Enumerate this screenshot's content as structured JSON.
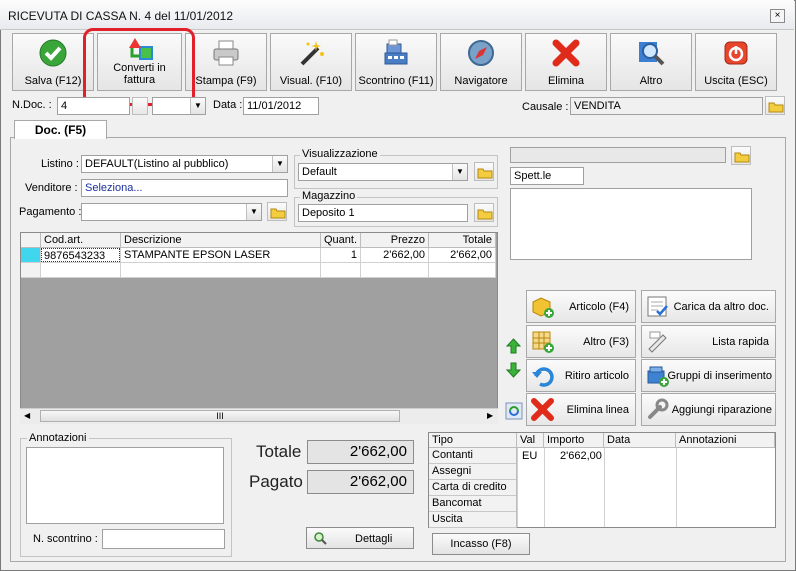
{
  "window": {
    "title": "RICEVUTA DI CASSA N. 4 del 11/01/2012",
    "close": "×"
  },
  "toolbar": {
    "buttons": [
      {
        "id": "salva",
        "label": "Salva (F12)",
        "icon": "check-icon"
      },
      {
        "id": "converti",
        "label_line1": "Converti in",
        "label_line2": "fattura",
        "icon": "convert-icon"
      },
      {
        "id": "stampa",
        "label": "Stampa (F9)",
        "icon": "printer-icon"
      },
      {
        "id": "visual",
        "label": "Visual. (F10)",
        "icon": "wand-icon"
      },
      {
        "id": "scontrino",
        "label": "Scontrino (F11)",
        "icon": "cash-register-icon"
      },
      {
        "id": "navigatore",
        "label": "Navigatore",
        "icon": "compass-icon"
      },
      {
        "id": "elimina",
        "label": "Elimina",
        "icon": "x-icon"
      },
      {
        "id": "altro",
        "label": "Altro",
        "icon": "magnifier-icon"
      },
      {
        "id": "uscita",
        "label": "Uscita (ESC)",
        "icon": "power-icon"
      }
    ]
  },
  "header": {
    "ndoc_label": "N.Doc. :",
    "ndoc_value": "4",
    "data_label": "Data :",
    "data_value": "11/01/2012",
    "causale_label": "Causale :",
    "causale_value": "VENDITA"
  },
  "tab": {
    "label": "Doc. (F5)"
  },
  "form": {
    "listino_label": "Listino :",
    "listino_value": "DEFAULT(Listino al pubblico)",
    "venditore_label": "Venditore :",
    "venditore_value": "Seleziona...",
    "pagamento_label": "Pagamento :",
    "pagamento_value": "",
    "visualizzazione_label": "Visualizzazione",
    "visualizzazione_value": "Default",
    "magazzino_label": "Magazzino",
    "magazzino_value": "Deposito 1",
    "spett": "Spett.le"
  },
  "grid": {
    "headers": [
      "Cod.art.",
      "Descrizione",
      "Quant.",
      "Prezzo",
      "Totale"
    ],
    "rows": [
      {
        "cod": "9876543233",
        "desc": "STAMPANTE EPSON LASER",
        "qty": "1",
        "price": "2'662,00",
        "total": "2'662,00"
      }
    ],
    "scroll_thumb": "III"
  },
  "actions": [
    {
      "id": "articolo",
      "label": "Articolo (F4)",
      "icon": "article-add-icon"
    },
    {
      "id": "carica",
      "label": "Carica da altro doc.",
      "icon": "checklist-icon"
    },
    {
      "id": "altro_f3",
      "label": "Altro (F3)",
      "icon": "grid-add-icon"
    },
    {
      "id": "lista",
      "label": "Lista rapida",
      "icon": "list-icon"
    },
    {
      "id": "ritiro",
      "label": "Ritiro articolo",
      "icon": "undo-icon"
    },
    {
      "id": "gruppi",
      "label": "Gruppi di inserimento",
      "icon": "group-add-icon"
    },
    {
      "id": "elimina_linea",
      "label": "Elimina linea",
      "icon": "x-icon"
    },
    {
      "id": "riparazione",
      "label": "Aggiungi riparazione",
      "icon": "wrench-icon"
    }
  ],
  "annotazioni": {
    "label": "Annotazioni",
    "value": ""
  },
  "scontrino": {
    "label": "N. scontrino :",
    "value": ""
  },
  "totals": {
    "totale_label": "Totale",
    "totale_value": "2'662,00",
    "pagato_label": "Pagato",
    "pagato_value": "2'662,00",
    "dettagli": "Dettagli"
  },
  "payments": {
    "headers": [
      "Tipo",
      "Val",
      "Importo",
      "Data",
      "Annotazioni"
    ],
    "rows": [
      {
        "tipo": "Contanti",
        "val": "EU",
        "importo": "2'662,00"
      },
      {
        "tipo": "Assegni",
        "val": "",
        "importo": ""
      },
      {
        "tipo": "Carta di credito",
        "val": "",
        "importo": ""
      },
      {
        "tipo": "Bancomat",
        "val": "",
        "importo": ""
      },
      {
        "tipo": "Uscita",
        "val": "",
        "importo": ""
      }
    ],
    "incasso": "Incasso (F8)"
  },
  "colors": {
    "highlight": "#e0202a",
    "row_indicator": "#3fd6ee",
    "link": "#1a2fa0"
  }
}
